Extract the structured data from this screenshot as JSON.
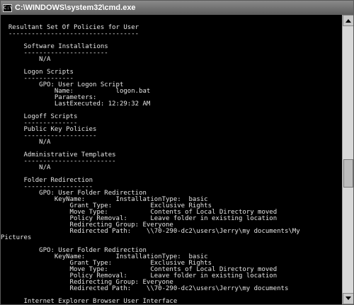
{
  "window": {
    "title": "C:\\WINDOWS\\system32\\cmd.exe",
    "icon": "console-app-icon",
    "icon_glyph": "C:\\"
  },
  "console": {
    "lines": [
      "",
      "  Resultant Set Of Policies for User",
      "  ----------------------------------",
      "",
      "      Software Installations",
      "      ----------------------",
      "          N/A",
      "",
      "      Logon Scripts",
      "      -------------",
      "          GPO: User Logon Script",
      "              Name:           logon.bat",
      "              Parameters:",
      "              LastExecuted: 12:29:32 AM",
      "",
      "      Logoff Scripts",
      "      --------------",
      "      Public Key Policies",
      "      -------------------",
      "          N/A",
      "",
      "      Administrative Templates",
      "      ------------------------",
      "          N/A",
      "",
      "      Folder Redirection",
      "      ------------------",
      "          GPO: User Folder Redirection",
      "              KeyName:        InstallationType:  basic",
      "                  Grant Type:          Exclusive Rights",
      "                  Move Type:           Contents of Local Directory moved",
      "                  Policy Removal:      Leave folder in existing location",
      "                  Redirecting Group: Everyone",
      "                  Redirected Path:    \\\\70-290-dc2\\users\\Jerry\\my documents\\My",
      "Pictures",
      "",
      "          GPO: User Folder Redirection",
      "              KeyName:        InstallationType:  basic",
      "                  Grant Type:          Exclusive Rights",
      "                  Move Type:           Contents of Local Directory moved",
      "                  Policy Removal:      Leave folder in existing location",
      "                  Redirecting Group: Everyone",
      "                  Redirected Path:    \\\\70-290-dc2\\users\\Jerry\\my documents",
      "",
      "      Internet Explorer Browser User Interface"
    ]
  },
  "colors": {
    "console_bg": "#000000",
    "console_text": "#e6e6e6",
    "titlebar": "#6e6e6e"
  }
}
